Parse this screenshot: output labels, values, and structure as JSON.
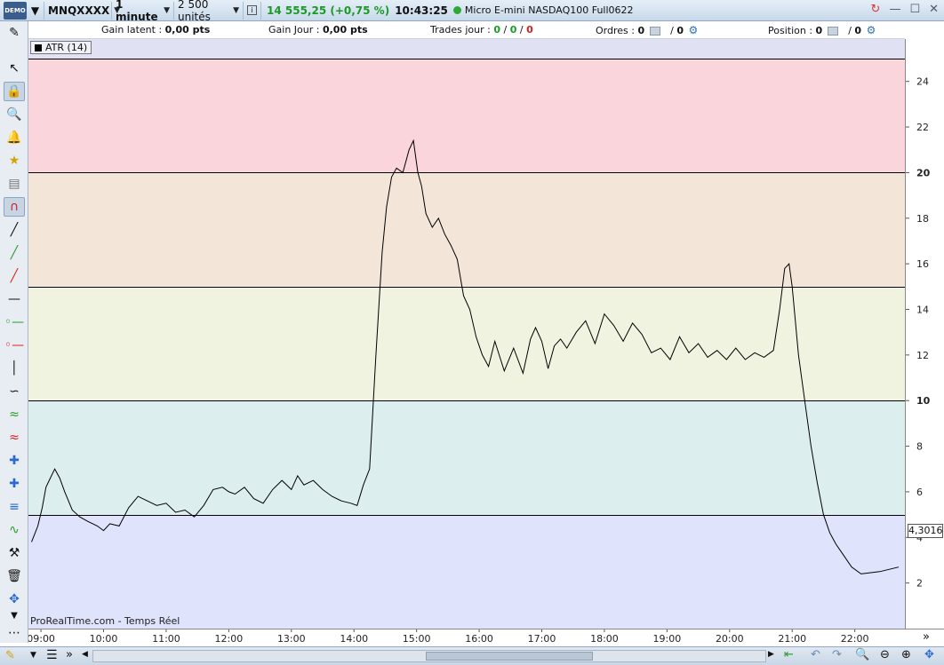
{
  "topbar": {
    "demo_label": "DEMO",
    "instrument": "MNQXXXX",
    "timeframe": "1 minute",
    "units": "2 500 unités",
    "info_icon": "i",
    "price_change": "14 555,25 (+0,75 %)",
    "time": "10:43:25",
    "description": "Micro E-mini NASDAQ100 Full0622"
  },
  "infobar": {
    "gain_latent_label": "Gain latent :",
    "gain_latent_value": "0,00 pts",
    "gain_jour_label": "Gain Jour :",
    "gain_jour_value": "0,00 pts",
    "trades_label": "Trades jour :",
    "trades_v1": "0",
    "trades_sep1": "/",
    "trades_v2": "0",
    "trades_sep2": "/",
    "trades_v3": "0",
    "ordres_label": "Ordres :",
    "ordres_v1": "0",
    "ordres_sep": "/",
    "ordres_v2": "0",
    "position_label": "Position :",
    "position_v1": "0",
    "position_sep": "/",
    "position_v2": "0"
  },
  "legend": {
    "indicator": "ATR (14)"
  },
  "watermark": "ProRealTime.com - Temps Réel",
  "last_value_label": "4,3016",
  "colors": {
    "band_over_20": "#fbd5dc",
    "band_15_20": "#f3e6d9",
    "band_10_15": "#f1f3e1",
    "band_5_10": "#dcefee",
    "band_below_5": "#dfe3fb",
    "header_band": "#e0e2f3",
    "line": "#000000",
    "price_up": "#1a9a25",
    "trade_red": "#d12020"
  },
  "chart_data": {
    "type": "line",
    "title": "ATR (14)",
    "xlabel": "",
    "ylabel": "",
    "ylim": [
      0,
      25.5
    ],
    "yticks": [
      2,
      4,
      6,
      8,
      10,
      12,
      14,
      16,
      18,
      20,
      22,
      24
    ],
    "ytick_labels": [
      "2",
      "4",
      "6",
      "8",
      "10",
      "12",
      "14",
      "16",
      "18",
      "20",
      "22",
      "24"
    ],
    "bold_ticks": [
      10,
      20
    ],
    "horizontal_levels": [
      5,
      10,
      15,
      20,
      25
    ],
    "x_tick_labels": [
      "09:00",
      "10:00",
      "11:00",
      "12:00",
      "13:00",
      "14:00",
      "15:00",
      "16:00",
      "17:00",
      "18:00",
      "19:00",
      "20:00",
      "21:00",
      "22:00"
    ],
    "x_tick_hours": [
      9,
      10,
      11,
      12,
      13,
      14,
      15,
      16,
      17,
      18,
      19,
      20,
      21,
      22
    ],
    "x_range_hours": [
      8.8,
      22.8
    ],
    "series": [
      {
        "x": [
          8.85,
          8.95,
          9.02,
          9.08,
          9.15,
          9.22,
          9.3,
          9.38,
          9.5,
          9.62,
          9.75,
          9.9,
          10.0,
          10.1,
          10.25,
          10.4,
          10.55,
          10.7,
          10.85,
          11.0,
          11.15,
          11.3,
          11.45,
          11.6,
          11.75,
          11.9,
          12.0,
          12.1,
          12.25,
          12.4,
          12.55,
          12.7,
          12.85,
          13.0,
          13.1,
          13.2,
          13.35,
          13.5,
          13.65,
          13.8,
          13.95,
          14.05,
          14.15,
          14.25,
          14.35,
          14.45,
          14.52,
          14.6,
          14.68,
          14.78,
          14.88,
          14.95,
          15.02,
          15.08,
          15.15,
          15.25,
          15.35,
          15.45,
          15.55,
          15.65,
          15.75,
          15.85,
          15.95,
          16.05,
          16.15,
          16.25,
          16.4,
          16.55,
          16.7,
          16.82,
          16.9,
          17.0,
          17.1,
          17.2,
          17.3,
          17.4,
          17.55,
          17.7,
          17.85,
          18.0,
          18.15,
          18.3,
          18.45,
          18.6,
          18.75,
          18.9,
          19.05,
          19.2,
          19.35,
          19.5,
          19.65,
          19.8,
          19.95,
          20.1,
          20.25,
          20.4,
          20.55,
          20.7,
          20.8,
          20.88,
          20.95,
          21.0,
          21.1,
          21.2,
          21.3,
          21.4,
          21.5,
          21.6,
          21.7,
          21.8,
          21.95,
          22.1,
          22.4,
          22.7
        ],
        "y": [
          3.8,
          4.5,
          5.3,
          6.2,
          6.6,
          7.0,
          6.6,
          6.0,
          5.2,
          4.9,
          4.7,
          4.5,
          4.3,
          4.6,
          4.5,
          5.3,
          5.8,
          5.6,
          5.4,
          5.5,
          5.1,
          5.2,
          4.9,
          5.4,
          6.1,
          6.2,
          6.0,
          5.9,
          6.2,
          5.7,
          5.5,
          6.1,
          6.5,
          6.1,
          6.7,
          6.3,
          6.5,
          6.1,
          5.8,
          5.6,
          5.5,
          5.4,
          6.3,
          7.0,
          12.0,
          16.5,
          18.5,
          19.8,
          20.2,
          20.0,
          21.0,
          21.4,
          20.0,
          19.4,
          18.2,
          17.6,
          18.0,
          17.3,
          16.8,
          16.2,
          14.6,
          14.0,
          12.8,
          12.0,
          11.5,
          12.6,
          11.3,
          12.3,
          11.2,
          12.7,
          13.2,
          12.6,
          11.4,
          12.4,
          12.7,
          12.3,
          13.0,
          13.5,
          12.5,
          13.8,
          13.3,
          12.6,
          13.4,
          12.9,
          12.1,
          12.3,
          11.8,
          12.8,
          12.1,
          12.5,
          11.9,
          12.2,
          11.8,
          12.3,
          11.8,
          12.1,
          11.9,
          12.2,
          14.0,
          15.8,
          16.0,
          15.0,
          12.0,
          10.0,
          8.0,
          6.4,
          5.0,
          4.2,
          3.7,
          3.3,
          2.7,
          2.4,
          2.5,
          2.7
        ]
      }
    ]
  }
}
